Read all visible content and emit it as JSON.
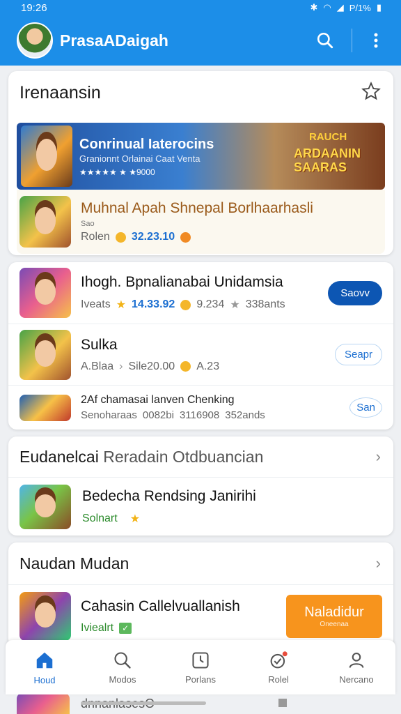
{
  "status": {
    "time": "19:26",
    "battery": "P/1%"
  },
  "app_bar": {
    "title": "PrasaADaigah"
  },
  "featured": {
    "title": "Irenaansin",
    "banner": {
      "headline": "Conrinual Iaterocins",
      "subline": "Granionnt Orlainai Caat Venta",
      "rating_text": "★★★★★  ★ ★9000",
      "game_logo": "ARDAANIN SAARAS",
      "game_logo_top": "RAUCH"
    },
    "game": {
      "name": "Muhnal Apah Shnepal Borlhaarhasli",
      "sub": "Sao",
      "meta_label": "Rolen",
      "rating": "32.23.10"
    }
  },
  "list_card": {
    "items": [
      {
        "name": "Ihogh. Bpnalianabai Unidamsia",
        "meta_label": "Iveats",
        "rating": "14.33.92",
        "extra": "9.234",
        "extra2": "338ants",
        "button": "Saovv"
      },
      {
        "name": "Sulka",
        "meta_label": "A.Blaa",
        "rating": "Sile20.00",
        "extra": "A.23",
        "extra2": "",
        "button": "Seapr"
      },
      {
        "name": "2Af chamasai lanven Chenking",
        "meta_label": "Senoharaas",
        "rating": "0082bi",
        "extra": "3116908",
        "extra2": "352ands",
        "button": "San"
      }
    ]
  },
  "section_two": {
    "title_bold": "Eudanelcai",
    "title_light": "Reradain Otdbuancian",
    "item": {
      "name": "Bedecha Rendsing Janirihi",
      "meta_label": "Solnart"
    }
  },
  "section_three": {
    "title": "Naudan Mudan",
    "item": {
      "name": "Cahasin Callelvuallanish",
      "meta_label": "Iviealrt",
      "button": "Naladidur",
      "button_sub": "Oneenaa"
    }
  },
  "peek_row": {
    "name": "dnnanlasesO"
  },
  "nav": [
    {
      "label": "Houd",
      "icon": "home-icon"
    },
    {
      "label": "Modos",
      "icon": "search-icon"
    },
    {
      "label": "Porlans",
      "icon": "clock-icon"
    },
    {
      "label": "Rolel",
      "icon": "notification-icon"
    },
    {
      "label": "Nercano",
      "icon": "profile-icon"
    }
  ],
  "colors": {
    "primary": "#1c8ee8",
    "accent_button": "#0d56b3",
    "orange": "#f7941d"
  }
}
